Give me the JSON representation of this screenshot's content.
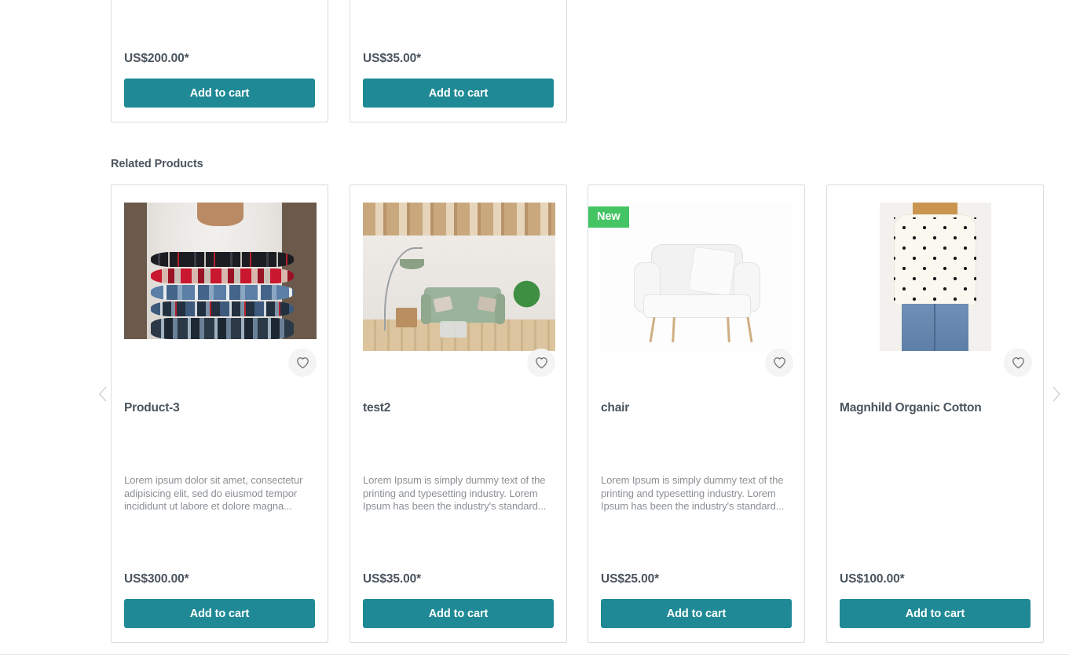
{
  "top_products": [
    {
      "price": "US$200.00*",
      "cart_label": "Add to cart"
    },
    {
      "price": "US$35.00*",
      "cart_label": "Add to cart"
    }
  ],
  "related_section": {
    "heading": "Related Products",
    "prev_label": "Previous products",
    "next_label": "Next products",
    "prev_icon": "chevron-left-icon",
    "next_icon": "chevron-right-icon"
  },
  "colors": {
    "accent_teal": "#1f8a95",
    "badge_green": "#45c463",
    "title_text": "#4a545e",
    "body_text": "#8b9096",
    "card_border": "#d8dde3",
    "arrow_gray": "#d3d6da"
  },
  "related_products": [
    {
      "title": "Product-3",
      "description": "Lorem ipsum dolor sit amet, consectetur adipisicing elit, sed do eiusmod tempor incididunt ut labore et dolore magna...",
      "price": "US$300.00*",
      "cart_label": "Add to cart",
      "badge": "",
      "wishlist_icon": "heart-icon",
      "image_alt": "stack-of-plaid-flannel-shirts"
    },
    {
      "title": "test2",
      "description": "Lorem Ipsum is simply dummy text of the printing and typesetting industry. Lorem Ipsum has been the industry's standard...",
      "price": "US$35.00*",
      "cart_label": "Add to cart",
      "badge": "",
      "wishlist_icon": "heart-icon",
      "image_alt": "living-room-with-green-sofa"
    },
    {
      "title": "chair",
      "description": "Lorem Ipsum is simply dummy text of the printing and typesetting industry. Lorem Ipsum has been the industry's standard...",
      "price": "US$25.00*",
      "cart_label": "Add to cart",
      "badge": "New",
      "wishlist_icon": "heart-icon",
      "image_alt": "white-tufted-armchair"
    },
    {
      "title": "Magnhild Organic Cotton",
      "description": "",
      "price": "US$100.00*",
      "cart_label": "Add to cart",
      "badge": "",
      "wishlist_icon": "heart-icon",
      "image_alt": "woman-wearing-heart-print-sweater"
    }
  ]
}
